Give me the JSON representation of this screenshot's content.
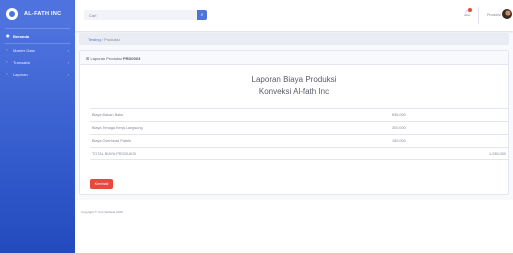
{
  "sidebar": {
    "brand": "AL-FATH INC",
    "items": [
      {
        "icon": "dashboard-icon",
        "label": "Beranda"
      },
      {
        "icon": "folder-icon",
        "label": "Master Data"
      },
      {
        "icon": "folder-icon",
        "label": "Transaksi"
      },
      {
        "icon": "folder-icon",
        "label": "Laporan"
      }
    ]
  },
  "topbar": {
    "search_placeholder": "Cari",
    "user_name": "Produksi"
  },
  "breadcrumb": {
    "link": "Testing",
    "separator": " / ",
    "current": "Produksi"
  },
  "card": {
    "header_label": "Laporan Produksi",
    "header_code": "PRD0003",
    "title": "Laporan Biaya Produksi",
    "subtitle": "Konveksi Al-fath Inc",
    "rows": [
      {
        "label": "Biaya Bahan Baku",
        "value": "835,000"
      },
      {
        "label": "Biaya Tenaga Kerja Langsung",
        "value": "300,000"
      },
      {
        "label": "Biaya Overhead Pabrik",
        "value": "150,000"
      }
    ],
    "total_label": "TOTAL BIAYA PRODUKSI",
    "total_value": "1,285,000",
    "back_button": "Kembali"
  },
  "footer": {
    "copyright": "Copyright © Your Website 2019"
  }
}
